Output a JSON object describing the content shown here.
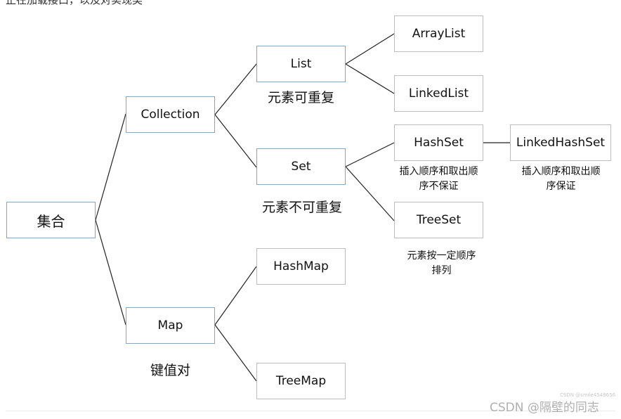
{
  "header": {
    "clipped_text": "正在加载接口，以及对实现类"
  },
  "nodes": {
    "root": "集合",
    "collection": "Collection",
    "map": "Map",
    "list": "List",
    "set": "Set",
    "arraylist": "ArrayList",
    "linkedlist": "LinkedList",
    "hashset": "HashSet",
    "linkedhashset": "LinkedHashSet",
    "treeset": "TreeSet",
    "hashmap": "HashMap",
    "treemap": "TreeMap"
  },
  "annotations": {
    "list": "元素可重复",
    "set": "元素不可重复",
    "map": "键值对",
    "hashset_line1": "插入顺序和取出顺",
    "hashset_line2": "序不保证",
    "linkedhashset_line1": "插入顺序和取出顺",
    "linkedhashset_line2": "序保证",
    "treeset_line1": "元素按一定顺序",
    "treeset_line2": "排列"
  },
  "edges": [
    [
      "root",
      "collection"
    ],
    [
      "root",
      "map"
    ],
    [
      "collection",
      "list"
    ],
    [
      "collection",
      "set"
    ],
    [
      "list",
      "arraylist"
    ],
    [
      "list",
      "linkedlist"
    ],
    [
      "set",
      "hashset"
    ],
    [
      "set",
      "treeset"
    ],
    [
      "hashset",
      "linkedhashset"
    ],
    [
      "map",
      "hashmap"
    ],
    [
      "map",
      "treemap"
    ]
  ],
  "watermark": {
    "small": "CSDN @smile4548656",
    "big": "CSDN @隔壁的同志"
  },
  "colors": {
    "interface_border": "#7aa7d6",
    "class_border": "#bdbdbd",
    "connector": "#222222"
  }
}
